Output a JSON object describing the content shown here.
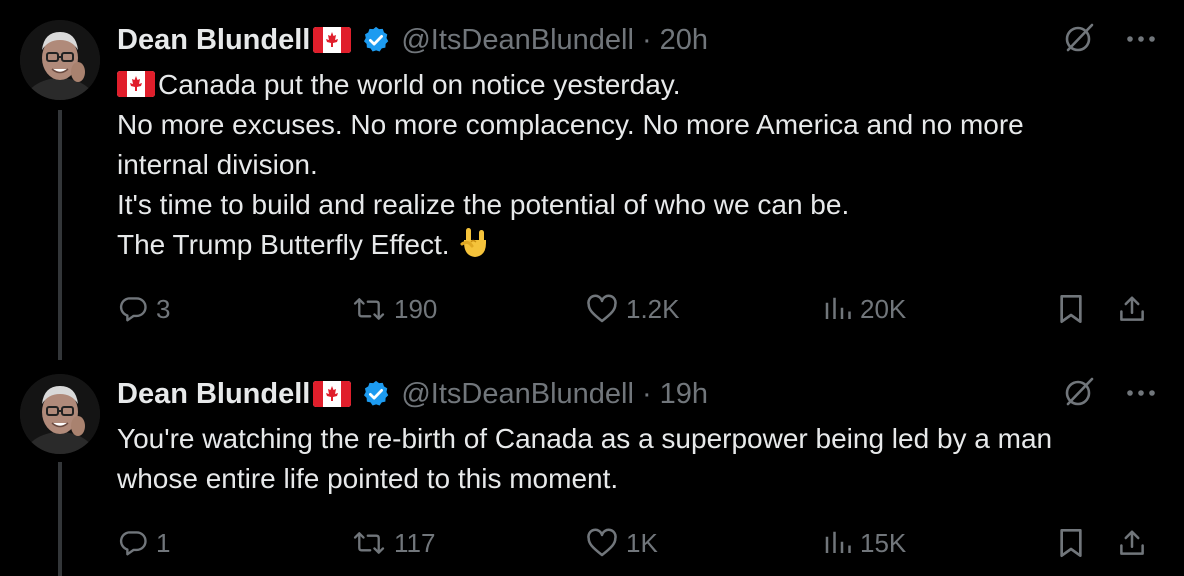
{
  "tweets": [
    {
      "display_name": "Dean Blundell",
      "handle": "@ItsDeanBlundell",
      "separator": "·",
      "time": "20h",
      "lines": [
        "Canada put the world on notice yesterday.",
        "No more excuses. No more complacency. No more America and no more",
        "internal division.",
        "It's time to build and realize the potential of who we can be.",
        "The Trump Butterfly Effect."
      ],
      "stats": {
        "replies": "3",
        "reposts": "190",
        "likes": "1.2K",
        "views": "20K"
      }
    },
    {
      "display_name": "Dean Blundell",
      "handle": "@ItsDeanBlundell",
      "separator": "·",
      "time": "19h",
      "lines": [
        "You're watching the re-birth of Canada as a superpower being led by a man",
        "whose entire life pointed to this moment."
      ],
      "stats": {
        "replies": "1",
        "reposts": "117",
        "likes": "1K",
        "views": "15K"
      }
    }
  ],
  "colors": {
    "background": "#000000",
    "text": "#e7e9ea",
    "muted": "#71767b",
    "verified": "#1d9bf0",
    "thread_line": "#333639",
    "flag_red": "#e01e2b"
  },
  "icons": [
    "canada-flag-icon",
    "verified-badge-icon",
    "grok-icon",
    "more-icon",
    "reply-icon",
    "repost-icon",
    "like-icon",
    "views-icon",
    "bookmark-icon",
    "share-icon",
    "rock-on-hand-emoji"
  ]
}
